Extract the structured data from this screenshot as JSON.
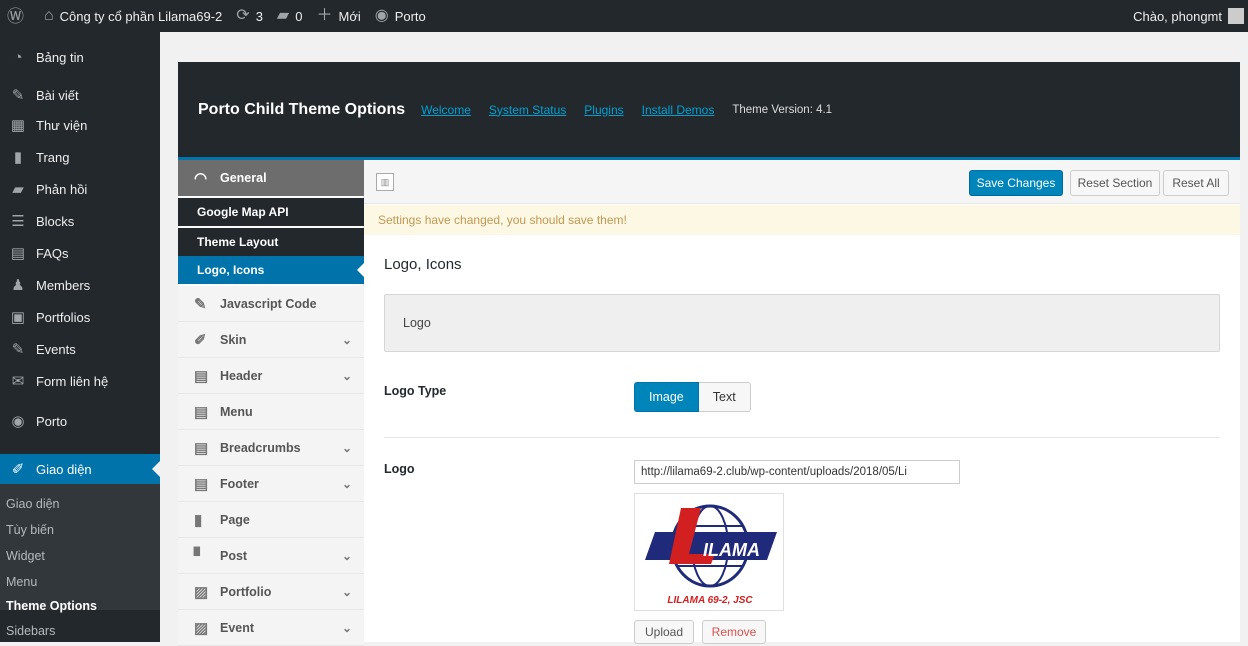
{
  "adminbar": {
    "site_name": "Công ty cổ phần Lilama69-2",
    "updates_count": "3",
    "comments_count": "0",
    "new_label": "Mới",
    "porto_label": "Porto",
    "greeting": "Chào, phongmt"
  },
  "menu": {
    "items": [
      {
        "label": "Bảng tin",
        "icon": "dashboard-icon"
      },
      {
        "label": "Bài viết",
        "icon": "pin-icon"
      },
      {
        "label": "Thư viện",
        "icon": "media-icon"
      },
      {
        "label": "Trang",
        "icon": "page-icon"
      },
      {
        "label": "Phản hồi",
        "icon": "comment-icon"
      },
      {
        "label": "Blocks",
        "icon": "blocks-icon"
      },
      {
        "label": "FAQs",
        "icon": "faq-icon"
      },
      {
        "label": "Members",
        "icon": "members-icon"
      },
      {
        "label": "Portfolios",
        "icon": "portfolio-icon"
      },
      {
        "label": "Events",
        "icon": "pin-icon"
      },
      {
        "label": "Form liên hệ",
        "icon": "mail-icon"
      },
      {
        "label": "Porto",
        "icon": "porto-icon"
      },
      {
        "label": "Giao diện",
        "icon": "brush-icon"
      }
    ],
    "submenu": [
      "Giao diện",
      "Tùy biến",
      "Widget",
      "Menu",
      "Theme Options",
      "Sidebars"
    ]
  },
  "header": {
    "title": "Porto Child Theme Options",
    "links": [
      "Welcome",
      "System Status",
      "Plugins",
      "Install Demos"
    ],
    "version": "Theme Version: 4.1"
  },
  "sidebar": {
    "general": "General",
    "general_subs": [
      "Google Map API",
      "Theme Layout",
      "Logo, Icons"
    ],
    "groups": [
      "Javascript Code",
      "Skin",
      "Header",
      "Menu",
      "Breadcrumbs",
      "Footer",
      "Page",
      "Post",
      "Portfolio",
      "Event"
    ]
  },
  "actions": {
    "save": "Save Changes",
    "reset_section": "Reset Section",
    "reset_all": "Reset All"
  },
  "notice": "Settings have changed, you should save them!",
  "section": {
    "title": "Logo, Icons",
    "box_label": "Logo",
    "logo_type_label": "Logo Type",
    "logo_type_options": [
      "Image",
      "Text"
    ],
    "logo_label": "Logo",
    "logo_url": "http://lilama69-2.club/wp-content/uploads/2018/05/Li",
    "logo_caption": "LILAMA 69-2, JSC",
    "logo_word": "LILAMA",
    "upload": "Upload",
    "remove": "Remove"
  },
  "colors": {
    "accent": "#0073aa",
    "brand_red": "#d21f1f",
    "brand_navy": "#1f2a7a"
  }
}
